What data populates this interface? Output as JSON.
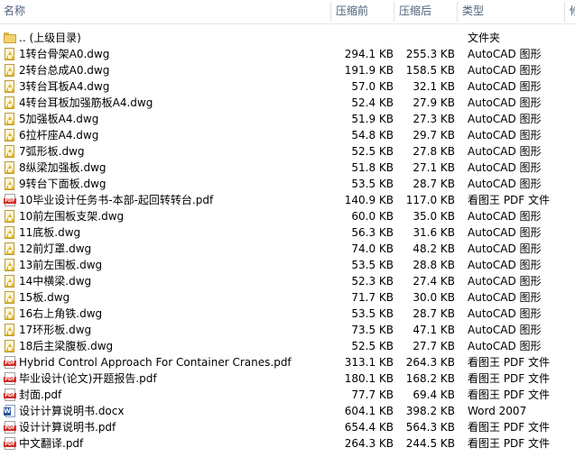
{
  "header": {
    "name": "名称",
    "size": "压缩前",
    "packed": "压缩后",
    "type": "类型",
    "more": "修"
  },
  "rows": [
    {
      "icon": "folder",
      "name": ".. (上级目录)",
      "size": "",
      "packed": "",
      "type": "文件夹"
    },
    {
      "icon": "dwg",
      "name": "1转台骨架A0.dwg",
      "size": "294.1 KB",
      "packed": "255.3 KB",
      "type": "AutoCAD 图形"
    },
    {
      "icon": "dwg",
      "name": "2转台总成A0.dwg",
      "size": "191.9 KB",
      "packed": "158.5 KB",
      "type": "AutoCAD 图形"
    },
    {
      "icon": "dwg",
      "name": "3转台耳板A4.dwg",
      "size": "57.0 KB",
      "packed": "32.1 KB",
      "type": "AutoCAD 图形"
    },
    {
      "icon": "dwg",
      "name": "4转台耳板加强筋板A4.dwg",
      "size": "52.4 KB",
      "packed": "27.9 KB",
      "type": "AutoCAD 图形"
    },
    {
      "icon": "dwg",
      "name": "5加强板A4.dwg",
      "size": "51.9 KB",
      "packed": "27.3 KB",
      "type": "AutoCAD 图形"
    },
    {
      "icon": "dwg",
      "name": "6拉杆座A4.dwg",
      "size": "54.8 KB",
      "packed": "29.7 KB",
      "type": "AutoCAD 图形"
    },
    {
      "icon": "dwg",
      "name": "7弧形板.dwg",
      "size": "52.5 KB",
      "packed": "27.8 KB",
      "type": "AutoCAD 图形"
    },
    {
      "icon": "dwg",
      "name": "8纵梁加强板.dwg",
      "size": "51.8 KB",
      "packed": "27.1 KB",
      "type": "AutoCAD 图形"
    },
    {
      "icon": "dwg",
      "name": "9转台下面板.dwg",
      "size": "53.5 KB",
      "packed": "28.7 KB",
      "type": "AutoCAD 图形"
    },
    {
      "icon": "pdf",
      "name": "10毕业设计任务书-本部-起回转转台.pdf",
      "size": "140.9 KB",
      "packed": "117.0 KB",
      "type": "看图王 PDF 文件"
    },
    {
      "icon": "dwg",
      "name": "10前左围板支架.dwg",
      "size": "60.0 KB",
      "packed": "35.0 KB",
      "type": "AutoCAD 图形"
    },
    {
      "icon": "dwg",
      "name": "11底板.dwg",
      "size": "56.3 KB",
      "packed": "31.6 KB",
      "type": "AutoCAD 图形"
    },
    {
      "icon": "dwg",
      "name": "12前灯罩.dwg",
      "size": "74.0 KB",
      "packed": "48.2 KB",
      "type": "AutoCAD 图形"
    },
    {
      "icon": "dwg",
      "name": "13前左围板.dwg",
      "size": "53.5 KB",
      "packed": "28.8 KB",
      "type": "AutoCAD 图形"
    },
    {
      "icon": "dwg",
      "name": "14中横梁.dwg",
      "size": "52.3 KB",
      "packed": "27.4 KB",
      "type": "AutoCAD 图形"
    },
    {
      "icon": "dwg",
      "name": "15板.dwg",
      "size": "71.7 KB",
      "packed": "30.0 KB",
      "type": "AutoCAD 图形"
    },
    {
      "icon": "dwg",
      "name": "16右上角铁.dwg",
      "size": "53.5 KB",
      "packed": "28.7 KB",
      "type": "AutoCAD 图形"
    },
    {
      "icon": "dwg",
      "name": "17环形板.dwg",
      "size": "73.5 KB",
      "packed": "47.1 KB",
      "type": "AutoCAD 图形"
    },
    {
      "icon": "dwg",
      "name": "18后主梁腹板.dwg",
      "size": "52.5 KB",
      "packed": "27.7 KB",
      "type": "AutoCAD 图形"
    },
    {
      "icon": "pdf",
      "name": "Hybrid Control Approach For Container Cranes.pdf",
      "size": "313.1 KB",
      "packed": "264.3 KB",
      "type": "看图王 PDF 文件"
    },
    {
      "icon": "pdf",
      "name": "毕业设计(论文)开题报告.pdf",
      "size": "180.1 KB",
      "packed": "168.2 KB",
      "type": "看图王 PDF 文件"
    },
    {
      "icon": "pdf",
      "name": "封面.pdf",
      "size": "77.7 KB",
      "packed": "69.4 KB",
      "type": "看图王 PDF 文件"
    },
    {
      "icon": "doc",
      "name": "设计计算说明书.docx",
      "size": "604.1 KB",
      "packed": "398.2 KB",
      "type": "Word 2007"
    },
    {
      "icon": "pdf",
      "name": "设计计算说明书.pdf",
      "size": "654.4 KB",
      "packed": "564.3 KB",
      "type": "看图王 PDF 文件"
    },
    {
      "icon": "pdf",
      "name": "中文翻译.pdf",
      "size": "264.3 KB",
      "packed": "244.5 KB",
      "type": "看图王 PDF 文件"
    }
  ]
}
